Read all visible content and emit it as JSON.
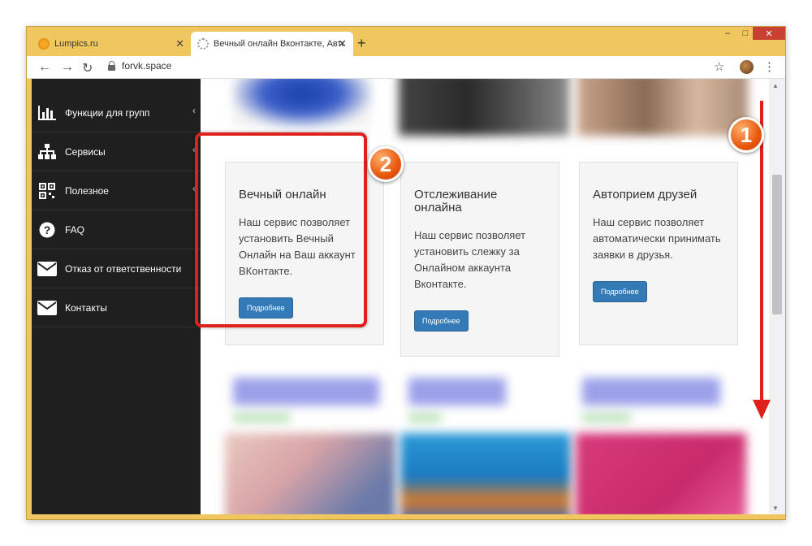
{
  "browser": {
    "tabs": [
      {
        "label": "Lumpics.ru",
        "active": false
      },
      {
        "label": "Вечный онлайн Вконтакте, Авто",
        "active": true
      }
    ],
    "new_tab": "+",
    "url": "forvk.space",
    "window_controls": {
      "minimize": "–",
      "maximize": "□",
      "close": "✕"
    }
  },
  "sidebar": {
    "items": [
      {
        "label": "Функции для групп",
        "icon": "bar-chart-icon",
        "has_submenu": true
      },
      {
        "label": "Сервисы",
        "icon": "sitemap-icon",
        "has_submenu": true
      },
      {
        "label": "Полезное",
        "icon": "qrcode-icon",
        "has_submenu": true
      },
      {
        "label": "FAQ",
        "icon": "question-circle-icon",
        "has_submenu": false
      },
      {
        "label": "Отказ от ответственности",
        "icon": "envelope-icon",
        "has_submenu": false
      },
      {
        "label": "Контакты",
        "icon": "envelope-icon",
        "has_submenu": false
      }
    ]
  },
  "cards": [
    {
      "title": "Вечный онлайн",
      "text": "Наш сервис позволяет установить Вечный Онлайн на Ваш аккаунт ВКонтакте.",
      "button": "Подробнее"
    },
    {
      "title": "Отслеживание онлайна",
      "text": "Наш сервис позволяет установить слежку за Онлайном аккаунта Вконтакте.",
      "button": "Подробнее"
    },
    {
      "title": "Автоприем друзей",
      "text": "Наш сервис позволяет автоматически принимать заявки в друзья.",
      "button": "Подробнее"
    }
  ],
  "annotations": {
    "badge1": "1",
    "badge2": "2"
  },
  "colors": {
    "accent_red": "#e0201c",
    "badge_orange": "#e8580c",
    "button_blue": "#337ab7",
    "sidebar_bg": "#1f1f1f",
    "window_frame": "#f0c75e"
  }
}
